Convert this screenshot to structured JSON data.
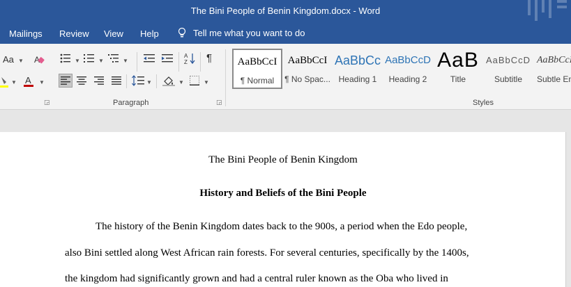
{
  "window": {
    "title": "The Bini People of Benin Kingdom.docx  -  Word"
  },
  "tabs": [
    {
      "label": "Mailings"
    },
    {
      "label": "Review"
    },
    {
      "label": "View"
    },
    {
      "label": "Help"
    }
  ],
  "tellme": {
    "label": "Tell me what you want to do",
    "icon": "lightbulb-icon"
  },
  "ribbon": {
    "font_group": {
      "change_case": "Aa"
    },
    "paragraph_group": {
      "label": "Paragraph"
    },
    "styles_group": {
      "label": "Styles"
    },
    "colors": {
      "highlight": "#ffff00",
      "font_color": "#c00000"
    }
  },
  "styles": [
    {
      "preview": "AaBbCcI",
      "name": "¶ Normal"
    },
    {
      "preview": "AaBbCcI",
      "name": "¶ No Spac..."
    },
    {
      "preview": "AaBbCc",
      "name": "Heading 1"
    },
    {
      "preview": "AaBbCcD",
      "name": "Heading 2"
    },
    {
      "preview": "AaB",
      "name": "Title"
    },
    {
      "preview": "AaBbCcD",
      "name": "Subtitle"
    },
    {
      "preview": "AaBbCcI",
      "name": "Subtle Em"
    }
  ],
  "document": {
    "title": "The Bini People of Benin Kingdom",
    "heading": "History and Beliefs of the Bini People",
    "lines": [
      "The history of the Benin Kingdom dates back to the 900s, a period when the Edo people,",
      "also Bini settled along West African rain forests. For several centuries, specifically by the 1400s,",
      "the kingdom had significantly grown and had a central ruler known as the Oba who lived in"
    ]
  }
}
